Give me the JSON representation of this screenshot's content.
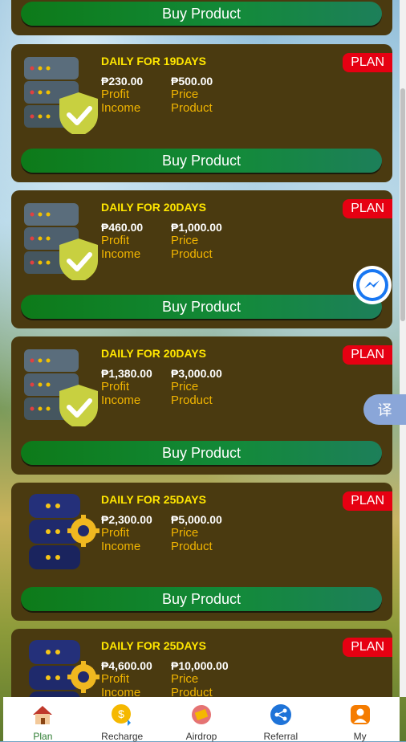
{
  "top_card": {
    "buy_label": "Buy Product"
  },
  "cards": [
    {
      "title": "DAILY FOR 19DAYS",
      "plan": "PLAN",
      "profit_value": "₱230.00",
      "profit_label": "Profit",
      "income_label": "Income",
      "price_value": "₱500.00",
      "price_label": "Price",
      "product_label": "Product",
      "buy_label": "Buy Product",
      "icon": "server-shield-icon"
    },
    {
      "title": "DAILY FOR 20DAYS",
      "plan": "PLAN",
      "profit_value": "₱460.00",
      "profit_label": "Profit",
      "income_label": "Income",
      "price_value": "₱1,000.00",
      "price_label": "Price",
      "product_label": "Product",
      "buy_label": "Buy Product",
      "icon": "server-shield-icon"
    },
    {
      "title": "DAILY FOR 20DAYS",
      "plan": "PLAN",
      "profit_value": "₱1,380.00",
      "profit_label": "Profit",
      "income_label": "Income",
      "price_value": "₱3,000.00",
      "price_label": "Price",
      "product_label": "Product",
      "buy_label": "Buy Product",
      "icon": "server-shield-icon"
    },
    {
      "title": "DAILY FOR 25DAYS",
      "plan": "PLAN",
      "profit_value": "₱2,300.00",
      "profit_label": "Profit",
      "income_label": "Income",
      "price_value": "₱5,000.00",
      "price_label": "Price",
      "product_label": "Product",
      "buy_label": "Buy Product",
      "icon": "server-gear-icon"
    },
    {
      "title": "DAILY FOR 25DAYS",
      "plan": "PLAN",
      "profit_value": "₱4,600.00",
      "profit_label": "Profit",
      "income_label": "Income",
      "price_value": "₱10,000.00",
      "price_label": "Price",
      "product_label": "Product",
      "icon": "server-gear-icon"
    }
  ],
  "floating": {
    "translate_label": "译"
  },
  "nav": [
    {
      "label": "Plan",
      "icon": "home-icon"
    },
    {
      "label": "Recharge",
      "icon": "coin-icon"
    },
    {
      "label": "Airdrop",
      "icon": "airdrop-icon"
    },
    {
      "label": "Referral",
      "icon": "share-icon"
    },
    {
      "label": "My",
      "icon": "user-icon"
    }
  ],
  "colors": {
    "accent_yellow": "#ffe600",
    "label_orange": "#f0b400",
    "plan_red": "#e60012",
    "card_brown": "#4a3a10",
    "button_green": "#0d7a19",
    "nav_active": "#2e7d32"
  }
}
